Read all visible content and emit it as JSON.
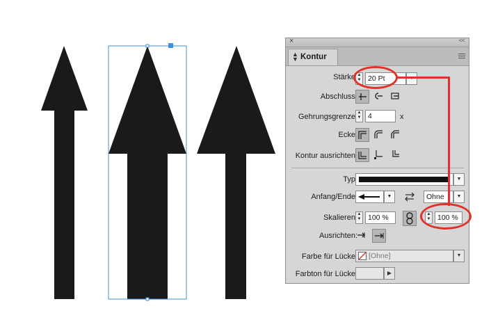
{
  "panel": {
    "tab_label": "Kontur",
    "close_glyph": "×",
    "collapse_glyph": "<<",
    "menu_icon": "panel-menu-icon",
    "staerke": {
      "label": "Stärke:",
      "value": "20 Pt"
    },
    "abschluss": {
      "label": "Abschluss:"
    },
    "gehrung": {
      "label": "Gehrungsgrenze:",
      "value": "4",
      "unit": "x"
    },
    "ecke": {
      "label": "Ecke:"
    },
    "ausrichten_kontur": {
      "label": "Kontur ausrichten:"
    },
    "typ": {
      "label": "Typ:"
    },
    "anfang_ende": {
      "label": "Anfang/Ende:",
      "end_value": "Ohne"
    },
    "skalieren": {
      "label": "Skalieren:",
      "start_value": "100 %",
      "end_value": "100 %"
    },
    "ausrichten": {
      "label": "Ausrichten:"
    },
    "farbe_luecke": {
      "label": "Farbe für Lücke:",
      "value": "[Ohne]"
    },
    "farbton_luecke": {
      "label": "Farbton für Lücke:"
    }
  },
  "colors": {
    "highlight": "#e0322a",
    "selection": "#3d8fe0",
    "arrow_fill": "#1a1a1a",
    "panel_bg": "#d6d6d6"
  }
}
